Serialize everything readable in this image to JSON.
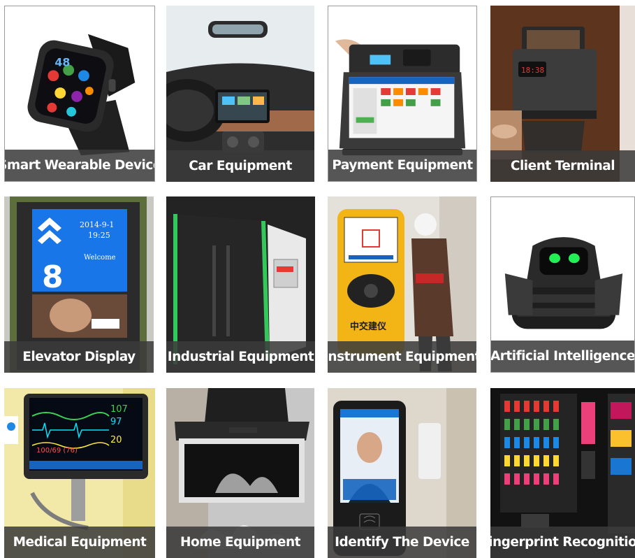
{
  "tiles": [
    {
      "label": "Smart Wearable Device",
      "photo": "smartwatch"
    },
    {
      "label": "Car Equipment",
      "photo": "car-dashboard"
    },
    {
      "label": "Payment Equipment",
      "photo": "pos-terminal"
    },
    {
      "label": "Client Terminal",
      "photo": "coffee-machine"
    },
    {
      "label": "Elevator Display",
      "photo": "elevator-screen"
    },
    {
      "label": "Industrial Equipment",
      "photo": "industrial-cabinet"
    },
    {
      "label": "Instrument Equipment",
      "photo": "handheld-instrument"
    },
    {
      "label": "Artificial Intelligence",
      "photo": "robot"
    },
    {
      "label": "Medical Equipment",
      "photo": "patient-monitor"
    },
    {
      "label": "Home Equipment",
      "photo": "range-hood"
    },
    {
      "label": "Identify The Device",
      "photo": "face-recognition-terminal"
    },
    {
      "label": "Fingerprint Recognition",
      "photo": "vending-machine"
    }
  ],
  "watch_screen": {
    "number": "48"
  },
  "elevator_screen": {
    "date": "2014-9-1",
    "time": "19:25",
    "welcome": "Welcome",
    "floor": "8"
  },
  "monitor_screen": {
    "hr": "107",
    "spo2": "97",
    "rr": "20",
    "nibp": "100/69 (76)"
  },
  "instrument_brand": "中交建仪",
  "coffee_display": "18:38",
  "colors": {
    "caption_bg": "#3a3a3a",
    "caption_text": "#ffffff",
    "elevator_blue": "#1976e8",
    "instrument_yellow": "#f2b515",
    "robot_eye_green": "#22ee55"
  }
}
